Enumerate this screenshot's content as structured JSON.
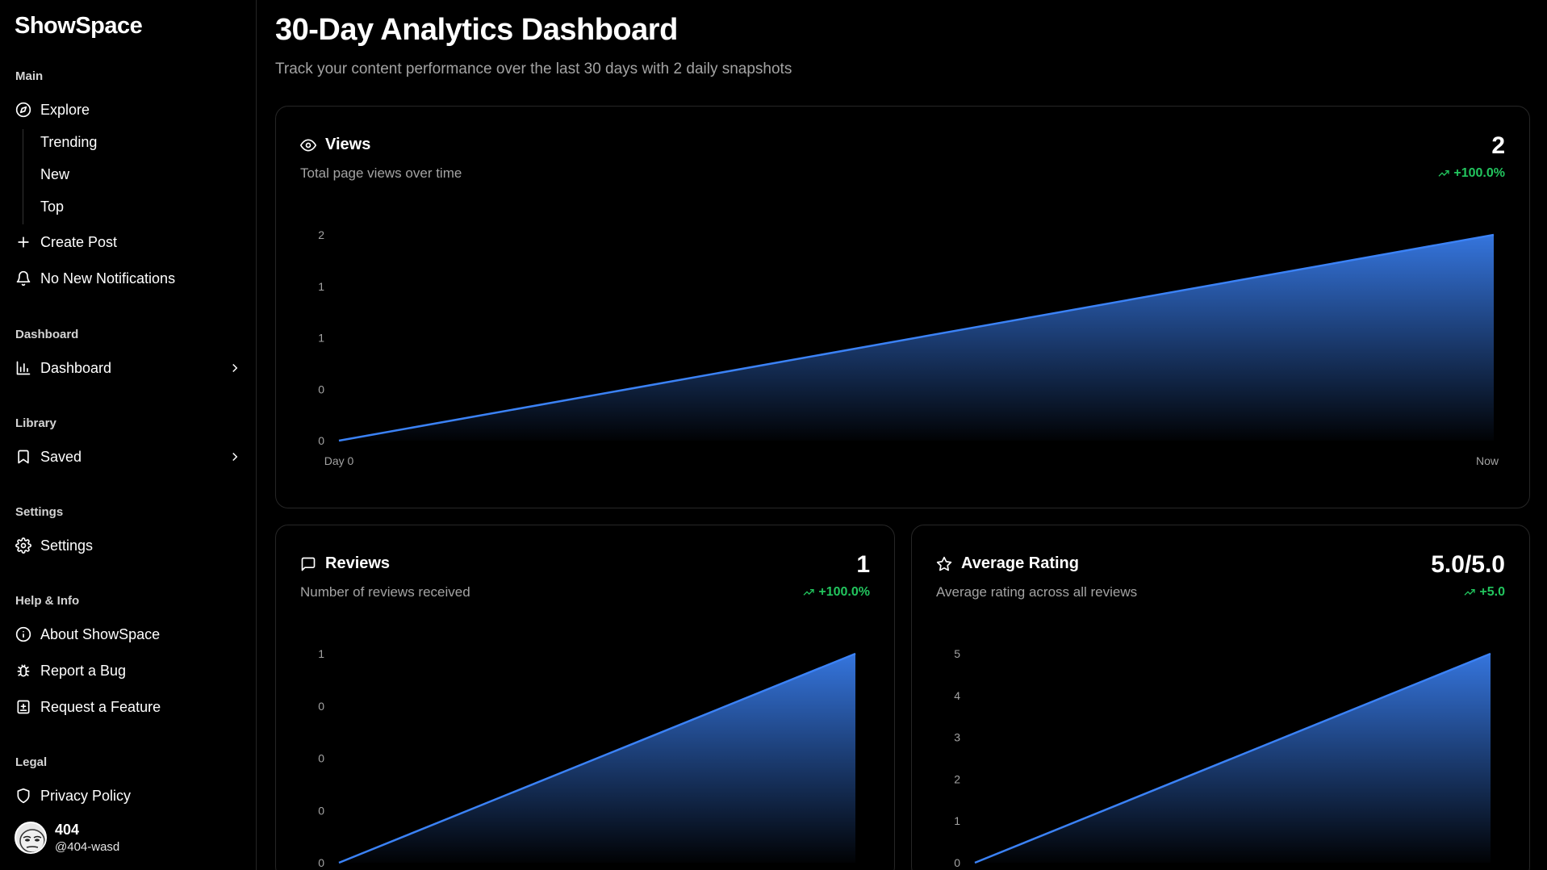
{
  "brand": "ShowSpace",
  "sidebar": {
    "main_label": "Main",
    "explore": "Explore",
    "sub": [
      "Trending",
      "New",
      "Top"
    ],
    "create_post": "Create Post",
    "notifications": "No New Notifications",
    "dashboard_label": "Dashboard",
    "dashboard": "Dashboard",
    "library_label": "Library",
    "saved": "Saved",
    "settings_label": "Settings",
    "settings": "Settings",
    "help_label": "Help & Info",
    "about": "About ShowSpace",
    "bug": "Report a Bug",
    "feature": "Request a Feature",
    "legal_label": "Legal",
    "privacy": "Privacy Policy"
  },
  "user": {
    "name": "404",
    "handle": "@404-wasd"
  },
  "header": {
    "title": "30-Day Analytics Dashboard",
    "subtitle": "Track your content performance over the last 30 days with 2 daily snapshots"
  },
  "cards": {
    "views": {
      "title": "Views",
      "desc": "Total page views over time",
      "value": "2",
      "change": "+100.0%"
    },
    "reviews": {
      "title": "Reviews",
      "desc": "Number of reviews received",
      "value": "1",
      "change": "+100.0%"
    },
    "rating": {
      "title": "Average Rating",
      "desc": "Average rating across all reviews",
      "value": "5.0/5.0",
      "change": "+5.0"
    }
  },
  "colors": {
    "accent": "#3b82f6",
    "positive": "#22c55e"
  },
  "chart_data": [
    {
      "type": "area",
      "name": "views",
      "x": [
        "Day 0",
        "Now"
      ],
      "values": [
        0,
        2
      ],
      "ytick_labels": [
        "0",
        "0",
        "1",
        "1",
        "2"
      ],
      "ylim": [
        0,
        2
      ]
    },
    {
      "type": "area",
      "name": "reviews",
      "values": [
        0,
        1
      ],
      "ytick_labels": [
        "0",
        "0",
        "0",
        "0",
        "1"
      ],
      "ylim": [
        0,
        1
      ]
    },
    {
      "type": "area",
      "name": "rating",
      "values": [
        0,
        5
      ],
      "ytick_labels": [
        "0",
        "1",
        "2",
        "3",
        "4",
        "5"
      ],
      "ylim": [
        0,
        5
      ]
    }
  ]
}
